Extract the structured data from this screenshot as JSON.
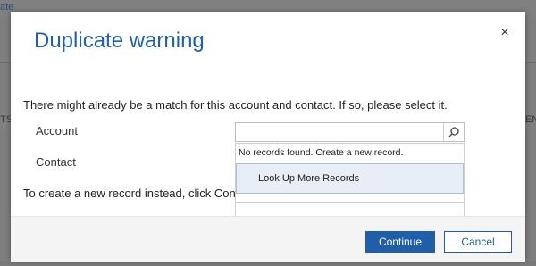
{
  "background": {
    "top_link": "ate",
    "left_fragment": "TS",
    "right_fragment": "EN"
  },
  "dialog": {
    "title": "Duplicate warning",
    "close_glyph": "×",
    "message": "There might already be a match for this account and contact. If so, please select it.",
    "fields": {
      "account_label": "Account",
      "contact_label": "Contact"
    },
    "create_text": "To create a new record instead, click Continue.",
    "lookup": {
      "value": "",
      "dropdown": {
        "no_records_text": "No records found. Create a new record.",
        "look_up_more_label": "Look Up More Records"
      }
    },
    "buttons": {
      "continue_label": "Continue",
      "cancel_label": "Cancel"
    }
  },
  "colors": {
    "title": "#2060b0",
    "primary_button": "#1f5ea8",
    "overlay": "#7f7f7f",
    "highlight_row": "#e8eef6"
  }
}
